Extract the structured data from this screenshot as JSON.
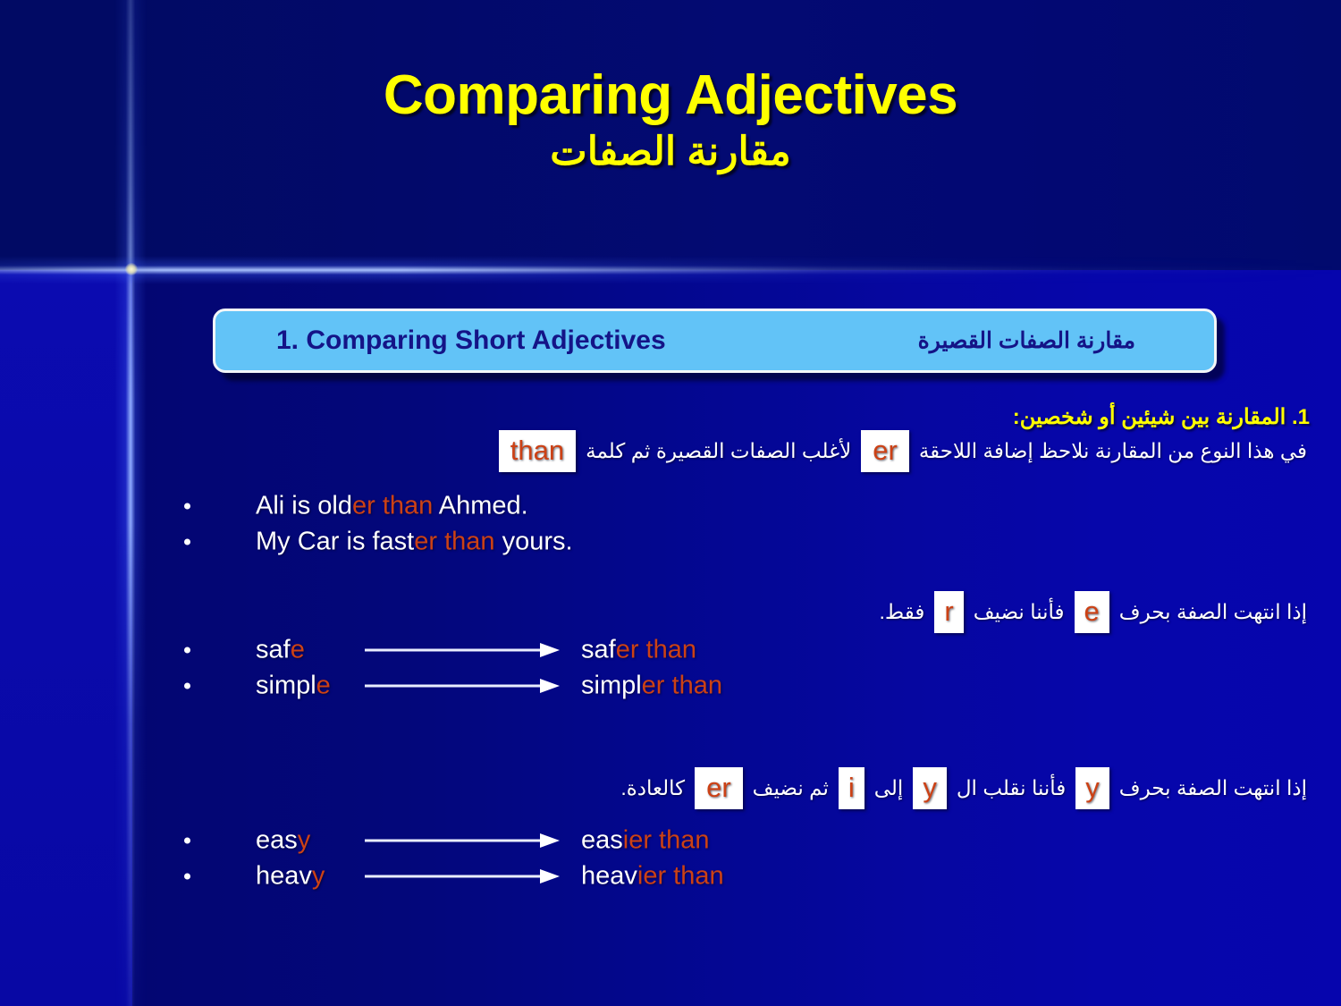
{
  "slide": {
    "title_en": "Comparing Adjectives",
    "title_ar": "مقارنة الصفات",
    "banner": {
      "label_en": "1. Comparing Short Adjectives",
      "label_ar": "مقارنة الصفات القصيرة",
      "bg_color": "#62c3f7",
      "text_color": "#141487"
    },
    "colors": {
      "background_top": "#010a64",
      "background_bottom": "#0606a8",
      "title": "#ffff00",
      "highlight": "#cc4115",
      "body_text": "#ffffff",
      "chip_bg": "#ffffff"
    },
    "rules": [
      {
        "heading_ar": "1. المقارنة بين شيئين أو شخصين:",
        "body_parts": [
          {
            "type": "text",
            "value": "في هذا النوع من المقارنة نلاحظ إضافة اللاحقة"
          },
          {
            "type": "chip",
            "value": "er"
          },
          {
            "type": "text",
            "value": "لأغلب الصفات القصيرة ثم كلمة"
          },
          {
            "type": "chip",
            "value": "than"
          }
        ]
      },
      {
        "heading_ar": "",
        "body_parts": [
          {
            "type": "text",
            "value": "إذا انتهت الصفة بحرف"
          },
          {
            "type": "chip",
            "value": "e"
          },
          {
            "type": "text",
            "value": "فأننا نضيف"
          },
          {
            "type": "chip",
            "value": "r"
          },
          {
            "type": "text",
            "value": "فقط."
          }
        ]
      },
      {
        "heading_ar": "",
        "body_parts": [
          {
            "type": "text",
            "value": "إذا انتهت الصفة بحرف"
          },
          {
            "type": "chip",
            "value": "y"
          },
          {
            "type": "text",
            "value": "فأننا نقلب ال"
          },
          {
            "type": "chip",
            "value": "y"
          },
          {
            "type": "text",
            "value": "إلى"
          },
          {
            "type": "chip",
            "value": "i"
          },
          {
            "type": "text",
            "value": "ثم نضيف"
          },
          {
            "type": "chip",
            "value": "er"
          },
          {
            "type": "text",
            "value": "كالعادة."
          }
        ]
      }
    ],
    "examples_group1": [
      {
        "prefix": "Ali is old",
        "highlight": "er than",
        "suffix": " Ahmed."
      },
      {
        "prefix": "My Car is fast",
        "highlight": "er than",
        "suffix": " yours."
      }
    ],
    "examples_group2": [
      {
        "base_prefix": "saf",
        "base_highlight": "e",
        "result_prefix": "saf",
        "result_highlight": "er than"
      },
      {
        "base_prefix": "simpl",
        "base_highlight": "e",
        "result_prefix": "simpl",
        "result_highlight": "er than"
      }
    ],
    "examples_group3": [
      {
        "base_prefix": "eas",
        "base_highlight": "y",
        "result_prefix": "eas",
        "result_highlight": "ier than"
      },
      {
        "base_prefix": "heav",
        "base_highlight": "y",
        "result_prefix": "heav",
        "result_highlight": "ier than"
      }
    ]
  }
}
